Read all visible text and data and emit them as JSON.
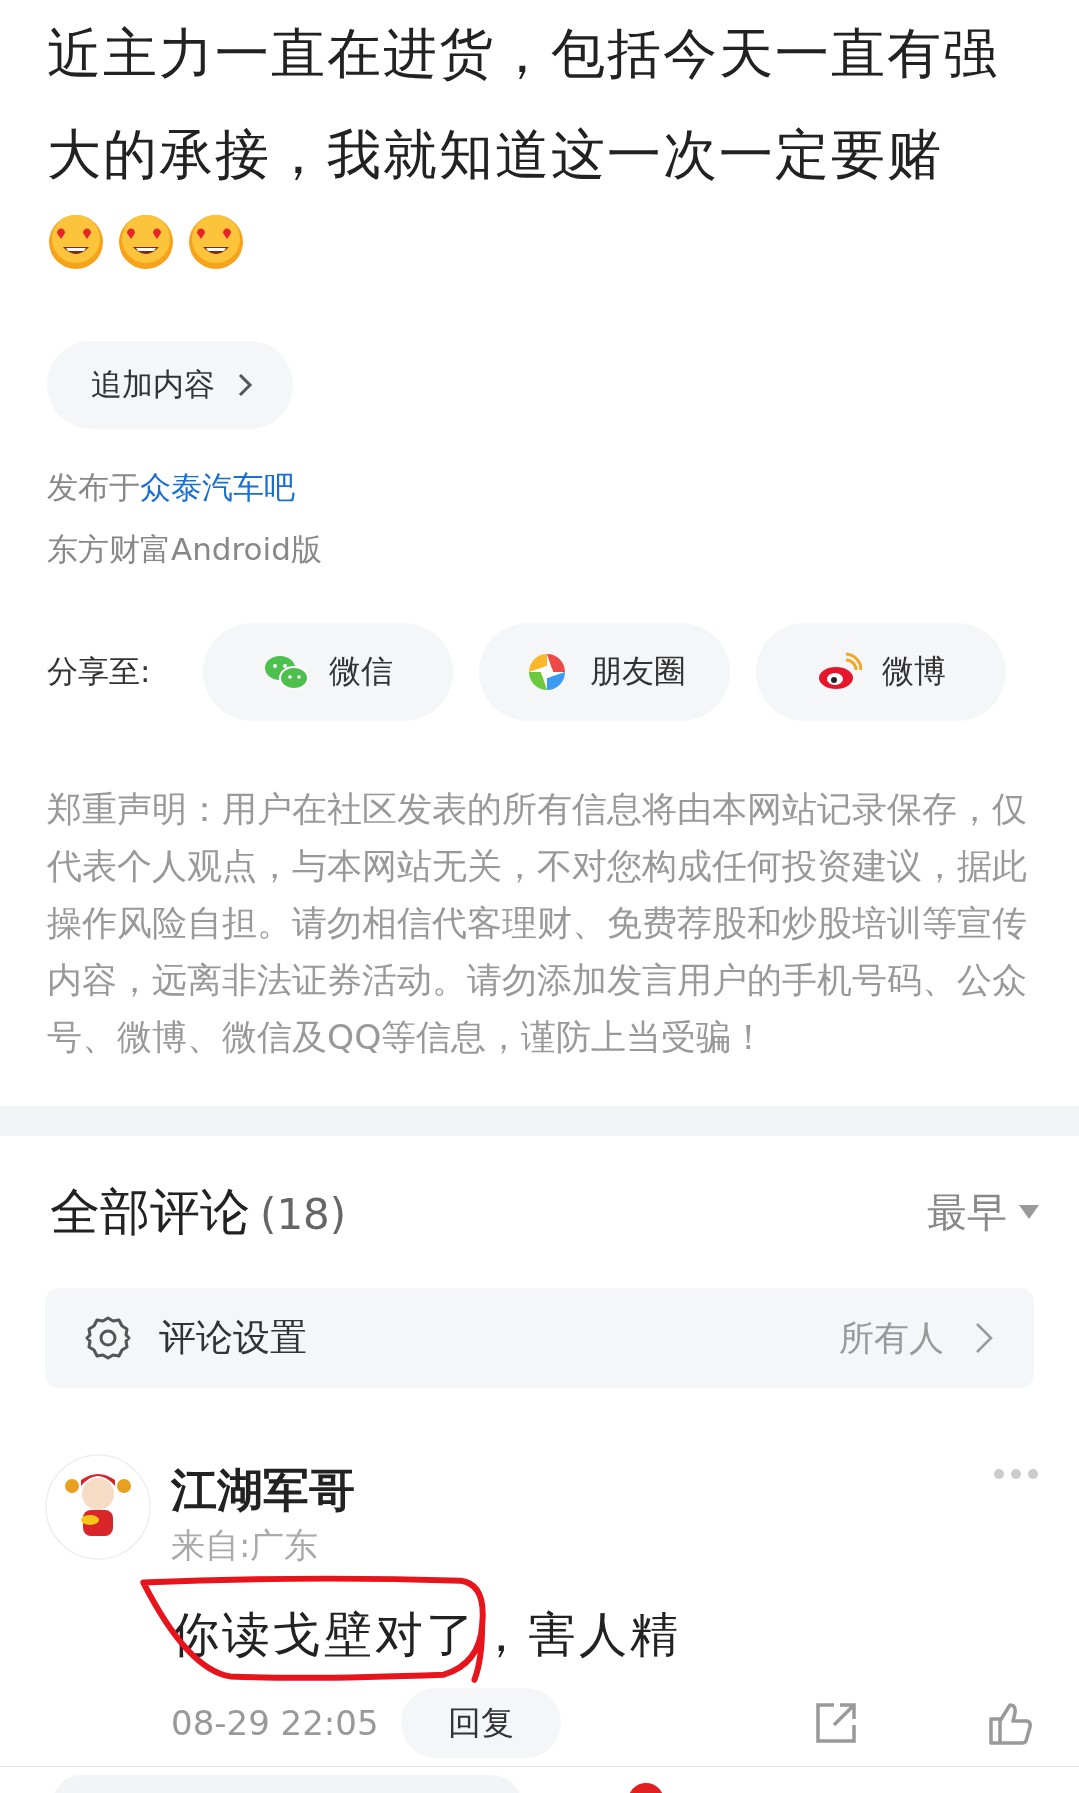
{
  "post": {
    "body": "近主力一直在进货，包括今天一直有强大的承接，我就知道这一次一定要赌",
    "emojis": [
      {
        "kind": "heart_eyes"
      },
      {
        "kind": "heart_eyes"
      },
      {
        "kind": "heart_eyes"
      }
    ],
    "append_button": "追加内容",
    "published_prefix": "发布于",
    "forum_link": "众泰汽车吧",
    "client": "东方财富Android版"
  },
  "share": {
    "label": "分享至:",
    "targets": [
      {
        "kind": "wechat",
        "label": "微信"
      },
      {
        "kind": "moments",
        "label": "朋友圈"
      },
      {
        "kind": "weibo",
        "label": "微博"
      }
    ]
  },
  "disclaimer": "郑重声明：用户在社区发表的所有信息将由本网站记录保存，仅代表个人观点，与本网站无关，不对您构成任何投资建议，据此操作风险自担。请勿相信代客理财、免费荐股和炒股培训等宣传内容，远离非法证券活动。请勿添加发言用户的手机号码、公众号、微博、微信及QQ等信息，谨防上当受骗！",
  "comments": {
    "title": "全部评论",
    "count": "(18)",
    "sort": "最早",
    "settings_label": "评论设置",
    "settings_value": "所有人",
    "items": [
      {
        "user": "江湖军哥",
        "location": "来自:广东",
        "text": "你读戈壁对了，害人精",
        "time": "08-29 22:05",
        "reply": "回复",
        "circled": true
      }
    ]
  }
}
